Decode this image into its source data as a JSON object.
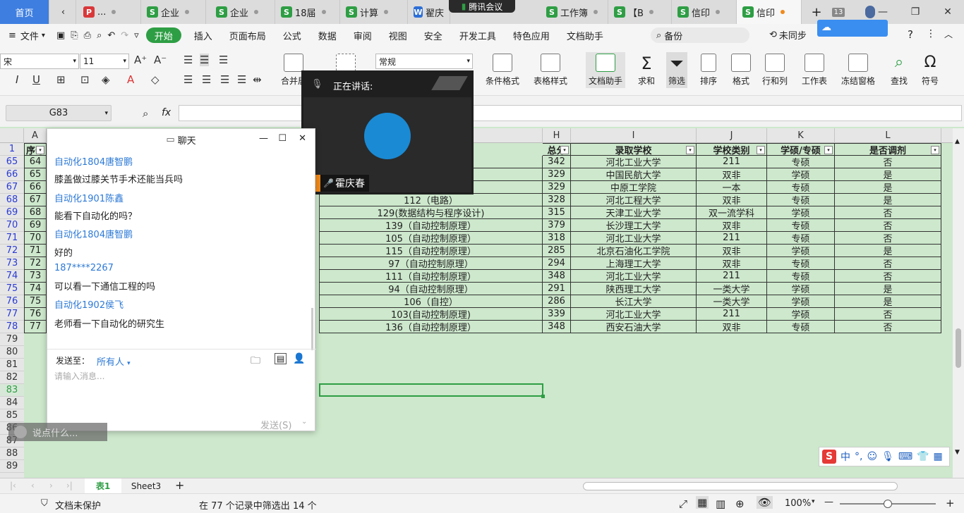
{
  "tabs": [
    {
      "label": "首页",
      "kind": "home"
    },
    {
      "label": "...",
      "icon": "P",
      "color": "#d9383a"
    },
    {
      "label": "企业",
      "icon": "S",
      "color": "#2e9e44"
    },
    {
      "label": "企业",
      "icon": "S",
      "color": "#2e9e44"
    },
    {
      "label": "18届",
      "icon": "S",
      "color": "#2e9e44"
    },
    {
      "label": "计算",
      "icon": "S",
      "color": "#2e9e44"
    },
    {
      "label": "翟庆",
      "icon": "W",
      "color": "#2d6fd6"
    },
    {
      "label": "工作簿",
      "icon": "S",
      "color": "#2e9e44"
    },
    {
      "label": "【B",
      "icon": "S",
      "color": "#2e9e44"
    },
    {
      "label": "信印",
      "icon": "S",
      "color": "#2e9e44"
    },
    {
      "label": "信印",
      "icon": "S",
      "color": "#2e9e44",
      "active": true
    }
  ],
  "meeting_pill": "腾讯会议",
  "tab_count": "13",
  "menu": {
    "file": "文件",
    "items": [
      "开始",
      "插入",
      "页面布局",
      "公式",
      "数据",
      "审阅",
      "视图",
      "安全",
      "开发工具",
      "特色应用",
      "文档助手"
    ],
    "search": "备份",
    "sync": "未同步",
    "help": "?"
  },
  "ribbon": {
    "font_name": "宋",
    "font_size": "11",
    "number_format": "常规",
    "merge_label": "合并居",
    "buttons": [
      "条件格式",
      "表格样式",
      "文档助手",
      "求和",
      "筛选",
      "排序",
      "格式",
      "行和列",
      "工作表",
      "冻结窗格",
      "查找",
      "符号"
    ]
  },
  "namebox": "G83",
  "fx": "fx",
  "columns": [
    "A",
    "H",
    "I",
    "J",
    "K",
    "L"
  ],
  "header_row": {
    "num": "1",
    "a": "序号",
    "h": "总分",
    "i": "录取学校",
    "j": "学校类别",
    "k": "学硕/专硕",
    "l": "是否调剂"
  },
  "rows": [
    {
      "r": "65",
      "a": "64",
      "g": "",
      "h": "342",
      "i": "河北工业大学",
      "j": "211",
      "k": "专硕",
      "l": "否"
    },
    {
      "r": "66",
      "a": "65",
      "g": "",
      "h": "329",
      "i": "中国民航大学",
      "j": "双非",
      "k": "学硕",
      "l": "是"
    },
    {
      "r": "67",
      "a": "66",
      "g": "",
      "h": "329",
      "i": "中原工学院",
      "j": "一本",
      "k": "专硕",
      "l": "是"
    },
    {
      "r": "68",
      "a": "67",
      "g": "112（电路）",
      "h": "328",
      "i": "河北工程大学",
      "j": "双非",
      "k": "专硕",
      "l": "是"
    },
    {
      "r": "69",
      "a": "68",
      "g": "129(数据结构与程序设计)",
      "h": "315",
      "i": "天津工业大学",
      "j": "双一流学科",
      "k": "学硕",
      "l": "否"
    },
    {
      "r": "70",
      "a": "69",
      "g": "139（自动控制原理）",
      "h": "379",
      "i": "长沙理工大学",
      "j": "双非",
      "k": "专硕",
      "l": "否"
    },
    {
      "r": "71",
      "a": "70",
      "g": "105（自动控制原理）",
      "h": "318",
      "i": "河北工业大学",
      "j": "211",
      "k": "专硕",
      "l": "否"
    },
    {
      "r": "72",
      "a": "71",
      "g": "115（自动控制原理）",
      "h": "285",
      "i": "北京石油化工学院",
      "j": "双非",
      "k": "学硕",
      "l": "是"
    },
    {
      "r": "73",
      "a": "72",
      "g": "97（自动控制原理）",
      "h": "294",
      "i": "上海理工大学",
      "j": "双非",
      "k": "专硕",
      "l": "否"
    },
    {
      "r": "74",
      "a": "73",
      "g": "111（自动控制原理）",
      "h": "348",
      "i": "河北工业大学",
      "j": "211",
      "k": "专硕",
      "l": "否"
    },
    {
      "r": "75",
      "a": "74",
      "g": "94（自动控制原理）",
      "h": "291",
      "i": "陕西理工大学",
      "j": "一类大学",
      "k": "学硕",
      "l": "是"
    },
    {
      "r": "76",
      "a": "75",
      "g": "106（自控）",
      "h": "286",
      "i": "长江大学",
      "j": "一类大学",
      "k": "学硕",
      "l": "是"
    },
    {
      "r": "77",
      "a": "76",
      "g": "103(自动控制原理)",
      "h": "339",
      "i": "河北工业大学",
      "j": "211",
      "k": "学硕",
      "l": "否"
    },
    {
      "r": "78",
      "a": "77",
      "g": "136（自动控制原理）",
      "h": "348",
      "i": "西安石油大学",
      "j": "双非",
      "k": "专硕",
      "l": "否"
    }
  ],
  "empty_rows": [
    "79",
    "80",
    "81",
    "82",
    "83",
    "84",
    "85",
    "86",
    "87",
    "88",
    "89"
  ],
  "chat": {
    "title": "聊天",
    "messages": [
      {
        "name": "自动化1804唐智鹏",
        "text": "膝盖做过膝关节手术还能当兵吗"
      },
      {
        "name": "自动化1901陈鑫",
        "text": "能看下自动化的吗？"
      },
      {
        "name": "自动化1804唐智鹏",
        "text": "好的"
      },
      {
        "name": "187****2267",
        "text": "可以看一下通信工程的吗"
      },
      {
        "name": "自动化1902侯飞",
        "text": "老师看一下自动化的研究生"
      }
    ],
    "send_to_label": "发送至：",
    "send_to_value": "所有人",
    "placeholder": "请输入消息...",
    "send_button": "发送(S)",
    "say_something": "说点什么..."
  },
  "speaker": {
    "label": "正在讲话:",
    "name": "霍庆春"
  },
  "sheet_tabs": [
    "表1",
    "Sheet3"
  ],
  "status": {
    "protect": "文档未保护",
    "filter_info": "在 77 个记录中筛选出 14 个",
    "zoom": "100%"
  }
}
